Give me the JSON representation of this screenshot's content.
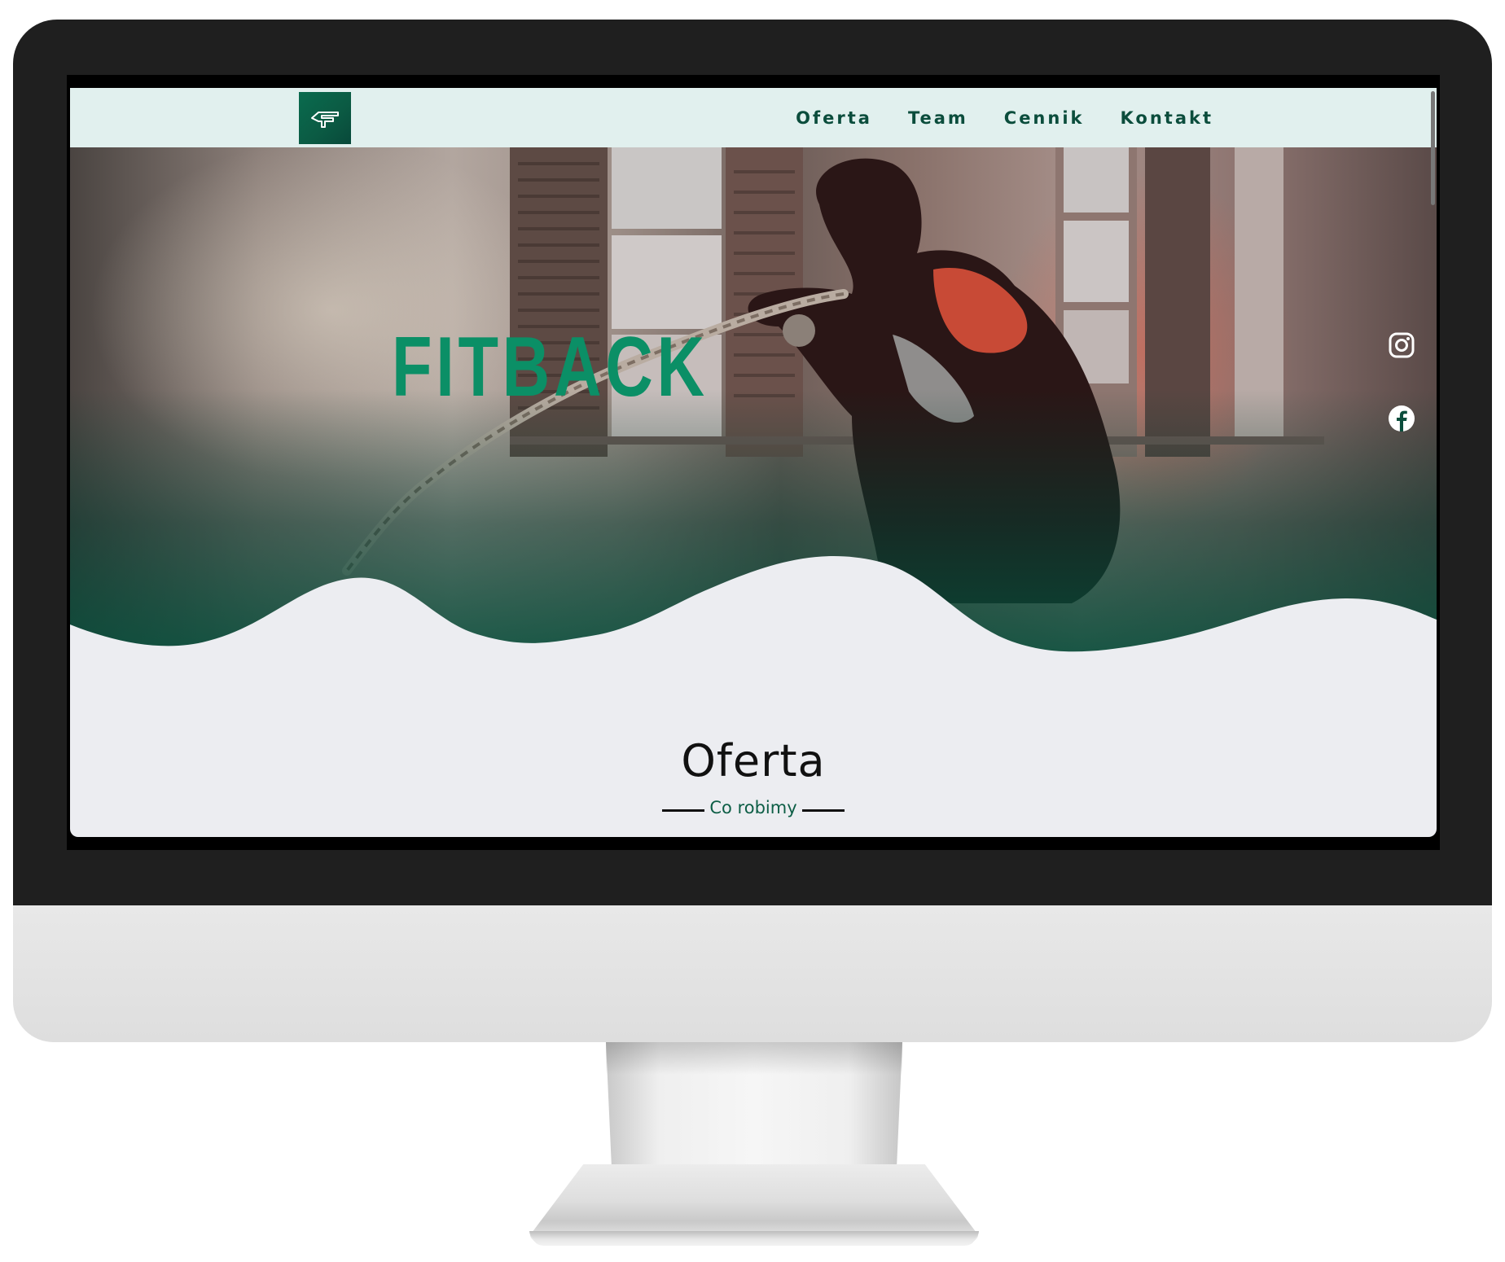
{
  "nav": {
    "logo_alt": "FitBack logo",
    "links": [
      "Oferta",
      "Team",
      "Cennik",
      "Kontakt"
    ]
  },
  "hero": {
    "title": "FITBACK"
  },
  "social": {
    "instagram_icon": "instagram-icon",
    "facebook_icon": "facebook-icon"
  },
  "section": {
    "title": "Oferta",
    "subtitle": "Co robimy"
  },
  "colors": {
    "brand_green": "#0b8f66",
    "nav_bg": "#e1f0ee",
    "nav_text": "#0b4d3c",
    "wave_green": "#06533f",
    "page_bg": "#ecedf1"
  }
}
